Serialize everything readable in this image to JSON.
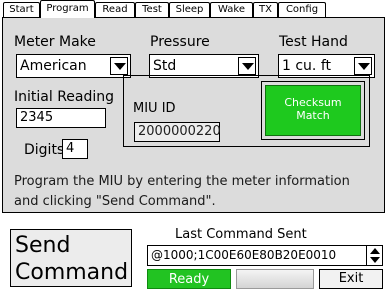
{
  "tabs": [
    {
      "label": "Start",
      "active": false
    },
    {
      "label": "Program",
      "active": true
    },
    {
      "label": "Read",
      "active": false
    },
    {
      "label": "Test",
      "active": false
    },
    {
      "label": "Sleep",
      "active": false
    },
    {
      "label": "Wake",
      "active": false
    },
    {
      "label": "TX",
      "active": false
    },
    {
      "label": "Config",
      "active": false
    }
  ],
  "program": {
    "meter_make_label": "Meter Make",
    "meter_make_value": "American",
    "pressure_label": "Pressure",
    "pressure_value": "Std",
    "test_hand_label": "Test Hand",
    "test_hand_value": "1 cu. ft",
    "initial_reading_label": "Initial Reading",
    "initial_reading_value": "2345",
    "digits_label": "Digits",
    "digits_value": "4",
    "miu_id_label": "MIU ID",
    "miu_id_value": "2000000220",
    "checksum_label": "Checksum Match",
    "checksum_color": "#1ec91e",
    "instructions": "Program the MIU by entering the meter information and clicking \"Send Command\"."
  },
  "footer": {
    "send_label": "Send Command",
    "last_command_label": "Last Command Sent",
    "last_command_value": "@1000;1C00E60E80B20E0010",
    "status_label": "Ready",
    "status_color": "#22c322",
    "exit_label": "Exit"
  }
}
